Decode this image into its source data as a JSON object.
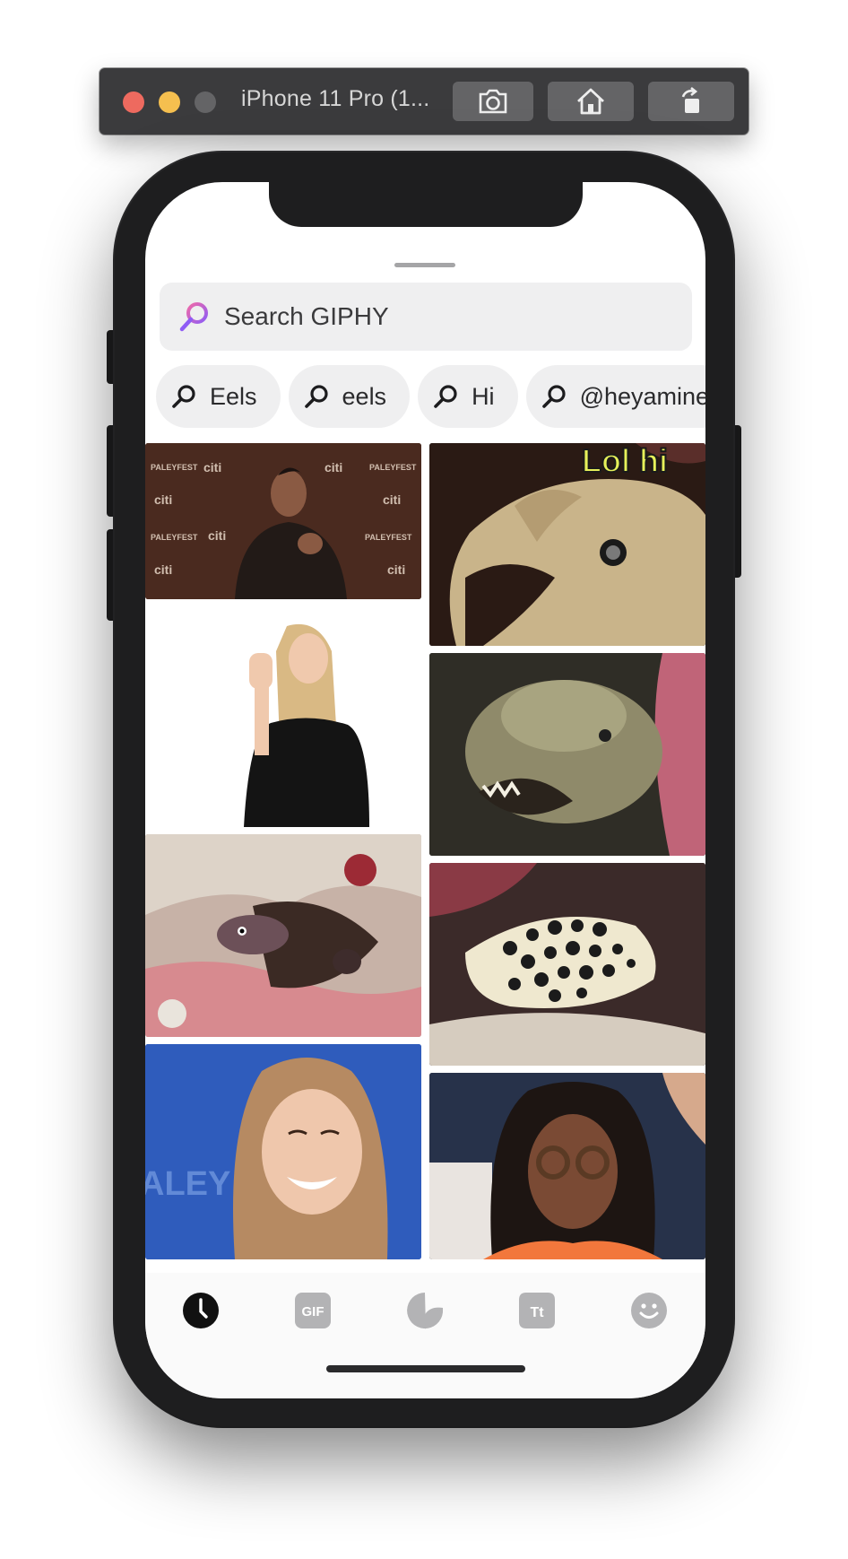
{
  "simulator": {
    "title": "iPhone 11 Pro (1...",
    "buttons": [
      "screenshot-icon",
      "home-icon",
      "rotate-icon"
    ]
  },
  "search": {
    "placeholder": "Search GIPHY",
    "icon": "search-icon",
    "accent_gradient": [
      "#f06aa8",
      "#8f5cf5"
    ]
  },
  "recent_searches": [
    {
      "label": "Eels"
    },
    {
      "label": "eels"
    },
    {
      "label": "Hi"
    },
    {
      "label": "@heyamine"
    }
  ],
  "gifs": [
    {
      "caption": "",
      "overlay_text": ""
    },
    {
      "caption": "",
      "overlay_text": "Lol hi"
    },
    {
      "caption": "",
      "overlay_text": ""
    },
    {
      "caption": "",
      "overlay_text": ""
    },
    {
      "caption": "",
      "overlay_text": ""
    },
    {
      "caption": "",
      "overlay_text": ""
    },
    {
      "caption": "",
      "overlay_text": ""
    },
    {
      "caption": "",
      "overlay_text": ""
    }
  ],
  "gif_backdrop_text": [
    "citi",
    "PALEYFEST",
    "ALEY"
  ],
  "tabbar": {
    "items": [
      {
        "icon": "clock-icon",
        "selected": true
      },
      {
        "icon": "gif-icon",
        "label": "GIF",
        "selected": false
      },
      {
        "icon": "sticker-icon",
        "selected": false
      },
      {
        "icon": "text-icon",
        "label": "Tt",
        "selected": false
      },
      {
        "icon": "emoji-icon",
        "selected": false
      }
    ]
  },
  "colors": {
    "selected_tab": "#111111",
    "inactive_tab": "#b3b3b5",
    "chip_bg": "#efeff0"
  }
}
